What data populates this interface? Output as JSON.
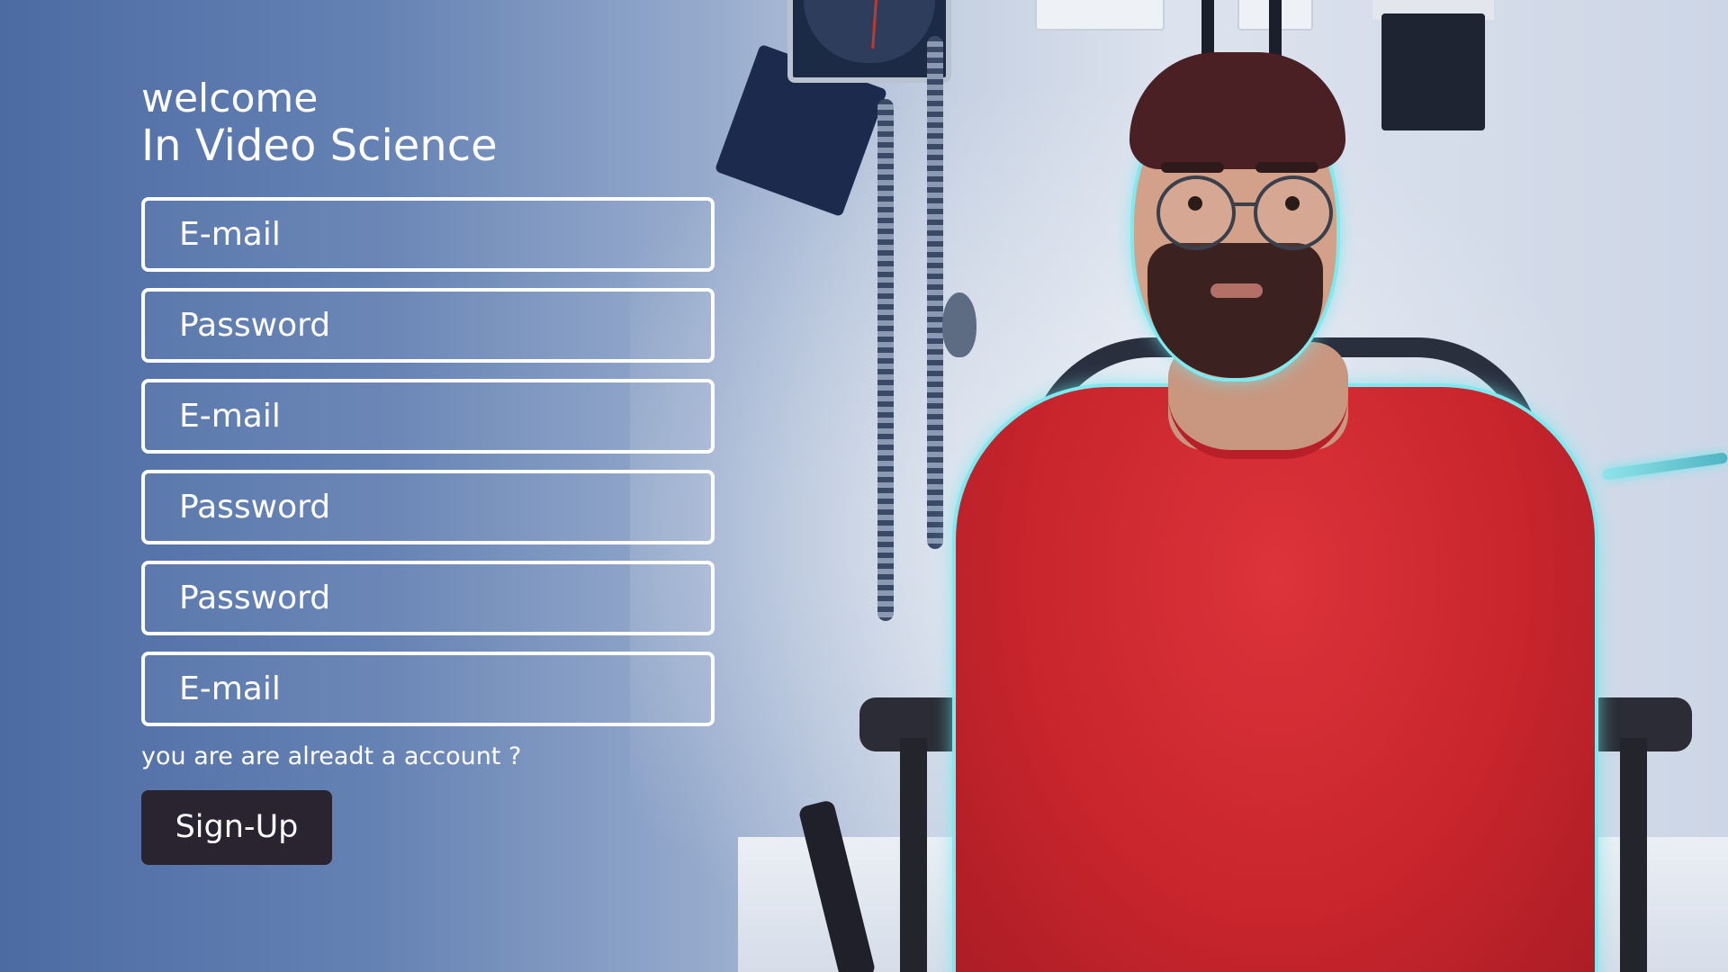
{
  "welcome": {
    "line1": "welcome",
    "line2": "In Video Science"
  },
  "form": {
    "fields": [
      {
        "placeholder": "E-mail"
      },
      {
        "placeholder": "Password"
      },
      {
        "placeholder": "E-mail"
      },
      {
        "placeholder": "Password"
      },
      {
        "placeholder": "Password"
      },
      {
        "placeholder": "E-mail"
      }
    ],
    "account_question": "you are are alreadt a account ?",
    "signup_label": "Sign-Up"
  },
  "colors": {
    "background_blue": "#4c6ba3",
    "button_dark": "#2a2430",
    "field_border": "#ffffff",
    "shirt_red": "#c8252d",
    "outline_glow": "#7ee9ef"
  }
}
